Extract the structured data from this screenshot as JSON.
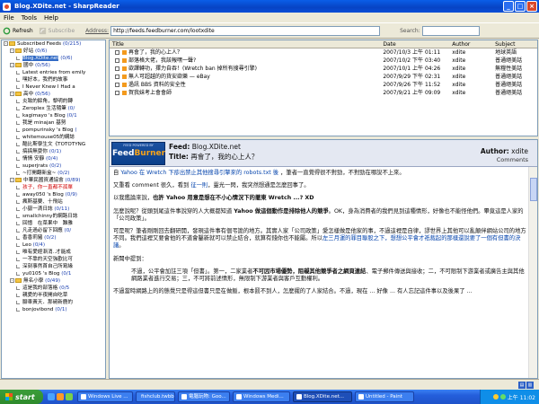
{
  "window": {
    "title": "Blog.XDite.net - SharpReader"
  },
  "menu": [
    "File",
    "Tools",
    "Help"
  ],
  "toolbar": {
    "refresh": "Refresh",
    "subscribe": "Subscribe",
    "address_label": "Address:",
    "address_value": "http://feeds.feedburner.com/lootxdite",
    "search_label": "Search:",
    "search_value": ""
  },
  "tree": [
    {
      "label": "Subscribed Feeds",
      "count": "(0/215)",
      "type": "folder",
      "level": 0
    },
    {
      "label": "好站",
      "count": "(0/6)",
      "type": "folder",
      "level": 1
    },
    {
      "label": "Blog.XDite.net",
      "count": "(0/6)",
      "type": "feed",
      "level": 2,
      "selected": true
    },
    {
      "label": "國中",
      "count": "(0/56)",
      "type": "folder",
      "level": 1
    },
    {
      "label": "Latest entries from emily",
      "count": "",
      "type": "feed",
      "level": 2
    },
    {
      "label": "嘿好本，我們的故事",
      "count": "",
      "type": "feed",
      "level": 2
    },
    {
      "label": "I Never Knew I Had a",
      "count": "",
      "type": "feed",
      "level": 2
    },
    {
      "label": "高中",
      "count": "(0/56)",
      "type": "folder",
      "level": 1
    },
    {
      "label": "炎致的餘角，黎明的轉",
      "count": "",
      "type": "feed",
      "level": 2
    },
    {
      "label": "Zeroplex 生活隨筆",
      "count": "(0/",
      "type": "feed",
      "level": 2
    },
    {
      "label": "kagimayo 's Blog",
      "count": "(0/1",
      "type": "feed",
      "level": 2
    },
    {
      "label": "我是 minajan 基努",
      "count": "",
      "type": "feed",
      "level": 2
    },
    {
      "label": "pompurinsky 's Blog",
      "count": "(",
      "type": "feed",
      "level": 2
    },
    {
      "label": "whitemouse05的網誌",
      "count": "",
      "type": "feed",
      "level": 2
    },
    {
      "label": "酷比斯學生文《TOTOTYNG",
      "count": "",
      "type": "feed",
      "level": 2
    },
    {
      "label": "搞搞無耍你",
      "count": "(0/1)",
      "type": "feed",
      "level": 2
    },
    {
      "label": "情情 安靜",
      "count": "(0/4)",
      "type": "feed",
      "level": 2
    },
    {
      "label": "superjrats",
      "count": "(0/2)",
      "type": "feed",
      "level": 2
    },
    {
      "label": "~打開翻新盒~",
      "count": "(0/2)",
      "type": "feed",
      "level": 2
    },
    {
      "label": "中華民國資通協會",
      "count": "(0/89)",
      "type": "folder",
      "level": 1
    },
    {
      "label": "孩子，你一直都不孤單",
      "count": "",
      "type": "feed",
      "level": 2,
      "red": true
    },
    {
      "label": "away050 's Blog",
      "count": "(0/9)",
      "type": "feed",
      "level": 2
    },
    {
      "label": "瘋斯基要、十飛站",
      "count": "",
      "type": "feed",
      "level": 2
    },
    {
      "label": "小嶽一滴日誌",
      "count": "(0/11)",
      "type": "feed",
      "level": 2
    },
    {
      "label": "smallchinny的網路日誌",
      "count": "",
      "type": "feed",
      "level": 2
    },
    {
      "label": "回憶　在菜果中　難雅",
      "count": "",
      "type": "feed",
      "level": 2
    },
    {
      "label": "凡走過必留下回應",
      "count": "(0/",
      "type": "feed",
      "level": 2
    },
    {
      "label": "香香莉豬",
      "count": "(0/2)",
      "type": "feed",
      "level": 2
    },
    {
      "label": "Leo",
      "count": "(0/4)",
      "type": "feed",
      "level": 2
    },
    {
      "label": "唯有愛經漸消..才能成",
      "count": "",
      "type": "feed",
      "level": 2
    },
    {
      "label": "一不靠的天空強歡比可",
      "count": "",
      "type": "feed",
      "level": 2
    },
    {
      "label": "深刻事然首自己所寫緣",
      "count": "",
      "type": "feed",
      "level": 2
    },
    {
      "label": "yu0105 's Blog",
      "count": "(0/1",
      "type": "feed",
      "level": 2
    },
    {
      "label": "無名小學",
      "count": "(0/49)",
      "type": "folder",
      "level": 1
    },
    {
      "label": "這是我的部落格",
      "count": "(0/5",
      "type": "feed",
      "level": 2
    },
    {
      "label": "親愛的半夜開自吃草",
      "count": "",
      "type": "feed",
      "level": 2
    },
    {
      "label": "腳車黃天．那碗新鹿的",
      "count": "",
      "type": "feed",
      "level": 2
    },
    {
      "label": "bonjovibond",
      "count": "(0/1)",
      "type": "feed",
      "level": 2
    }
  ],
  "list": {
    "headers": [
      "Title",
      "Date",
      "Author",
      "Subject"
    ],
    "rows": [
      {
        "title": "再會了，我的心上人？",
        "date": "2007/10/3 上午 01:11",
        "author": "xdite",
        "subject": "地球英語"
      },
      {
        "title": "部落格大佬，我該報嘿一聲?",
        "date": "2007/10/2 下午 03:40",
        "author": "xdite",
        "subject": "普通絕美話"
      },
      {
        "title": "欲譯轉功，擇力自吞！(Wretch ban 掉所有搜尋引擎)",
        "date": "2007/10/1 上午 04:26",
        "author": "xdite",
        "subject": "無糧性美話"
      },
      {
        "title": "無人可超越的的貨安欲樂 — eBay",
        "date": "2007/9/29 下午 02:31",
        "author": "xdite",
        "subject": "普通絕美話"
      },
      {
        "title": "過訊 BBS 資料的安全性",
        "date": "2007/9/26 下午 11:52",
        "author": "xdite",
        "subject": "普通絕美話"
      },
      {
        "title": "賀我妹考上會會師",
        "date": "2007/9/21 上午 09:09",
        "author": "xdite",
        "subject": "普通絕美話"
      }
    ]
  },
  "preview": {
    "logo_powered": "FEED POWERED BY",
    "logo_feed": "Feed",
    "logo_burner": "Burner",
    "feed_label": "Feed:",
    "feed_value": "Blog.XDite.net",
    "title_label": "Title:",
    "title_value": "再會了，我的心上人？",
    "author_label": "Author:",
    "author_value": "xdite",
    "comments": "Comments",
    "p1_pre": "自",
    "p1_link": "Yahoo 在 Wretch 下疹出禁止其他搜尋引擎來的 robots.txt 後",
    "p1_post": "，筆者一直覺得很不對勁，不對勁在哪說不上來。",
    "p2_pre": "又重看 comment 很久，看到",
    "p2_link": "征一則",
    "p2_post": "，靈光一閃，我突然想通是怎麼回事了。",
    "p3_pre": "以我鑑論來說，",
    "p3_bold": "也許 Yahoo 用意是想在不小心情況下的撤東 Wretch ...? XD",
    "p4_pre": "怎麼說呢？從頭到尾這件事說穿的人大概都知道 ",
    "p4_bold": "Yahoo 做這個動作是排除他人的競爭",
    "p4_post": "。OK，身為消費者的我們見到這種情形，好像也不能怪他們。畢竟這是人家的「公司政策」。",
    "p5": "可是呢？筆者剛剛回去翻研開，發現這件事有個弔詭的地方。其實人家「公司政策」愛怎樣做是他家的事，不過這裡是自律，謬世界上其他可以亂顛伴網站公司的地方不同。我們這裡又要會他的不道會鑿新就可以禁止結合，就算有錢你也不能屬。所以",
    "p5_link": "左三月運的罪目聯股之下，想想公平會才祇裁起的那樣還說要了一個有但書的決議",
    "p5_post": "。",
    "p6": "新聞中提到：",
    "p7_pre": "不過，公平會加註三項「但書」。第一，二家業者",
    "p7_bold": "不可因市場優勢，阻礙其他競爭者之網頁連結",
    "p7_post": "、電子郵件傳送與接收；二，不可限制下游業者或廣告主與其他網路業者進行交易；三，不可將前述情形，無限制下游業者與客戶互動權利。",
    "p8": "不過當時網路上的的態覺只是得這但書只是在做飯，根本罰不到人，怎麼擺的了人家結合。不過，現在 ... 好像 ... 有人忘記這件事以及後果了 ..."
  },
  "taskbar": {
    "start": "start",
    "tasks": [
      "Windows Live ...",
      "fishclub.twbbs...",
      "電腦玩物: Goo...",
      "Windows Medi...",
      "Blog.XDite.net...",
      "Untitled - Paint"
    ],
    "clock": "上午 11:02"
  }
}
